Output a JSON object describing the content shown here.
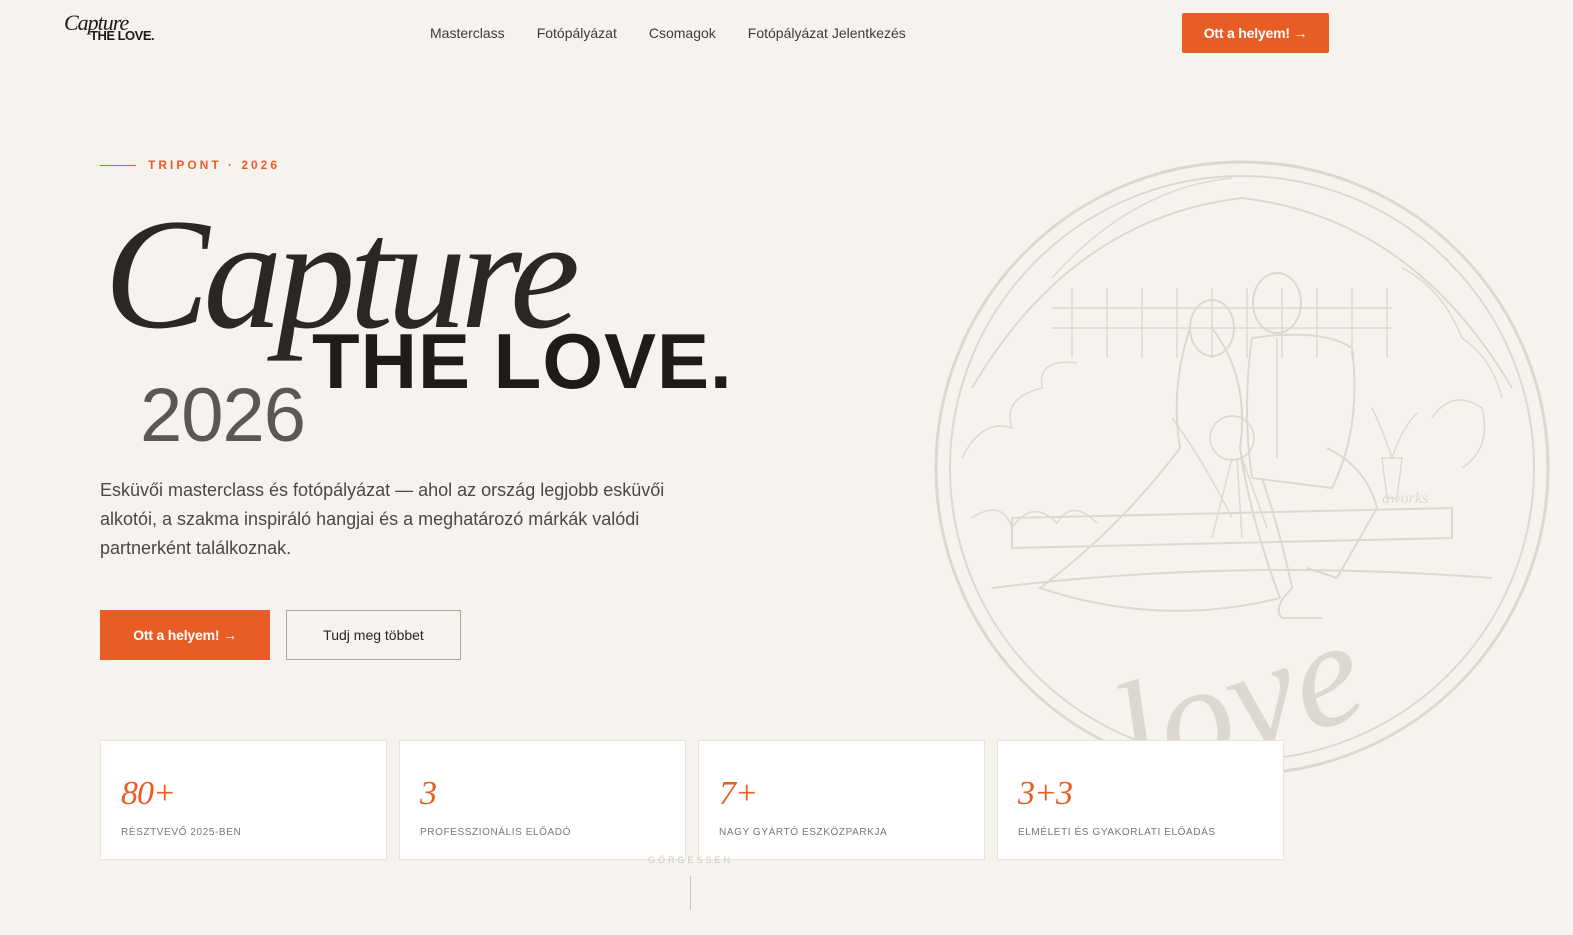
{
  "header": {
    "logo_line1": "Capture",
    "logo_line2": "THE LOVE.",
    "nav": [
      "Masterclass",
      "Fotópályázat",
      "Csomagok",
      "Fotópályázat Jelentkezés"
    ],
    "cta_label": "Ott a helyem! →"
  },
  "hero": {
    "eyebrow": "TRIPONT · 2026",
    "title_script": "Capture",
    "title_bold": "THE LOVE.",
    "title_year": "2026",
    "lead": "Esküvői masterclass és fotópályázat — ahol az ország legjobb esküvői alkotói, a szakma inspiráló hangjai és a meghatározó márkák valódi partnerként találkoznak.",
    "primary_button": "Ott a helyem! →",
    "secondary_button": "Tudj meg többet"
  },
  "illustration": {
    "script_word": "love",
    "tag": "aworks"
  },
  "stats": [
    {
      "value": "80+",
      "label": "RÉSZTVEVŐ 2025-BEN"
    },
    {
      "value": "3",
      "label": "PROFESSZIONÁLIS ELŐADÓ"
    },
    {
      "value": "7+",
      "label": "NAGY GYÁRTÓ ESZKÖZPARKJA"
    },
    {
      "value": "3+3",
      "label": "ELMÉLETI ÉS GYAKORLATI ELŐADÁS"
    }
  ],
  "scroll_hint": "GÖRGESSEN",
  "colors": {
    "accent": "#e85d26",
    "background": "#f6f3ee",
    "text": "#2a2623"
  }
}
